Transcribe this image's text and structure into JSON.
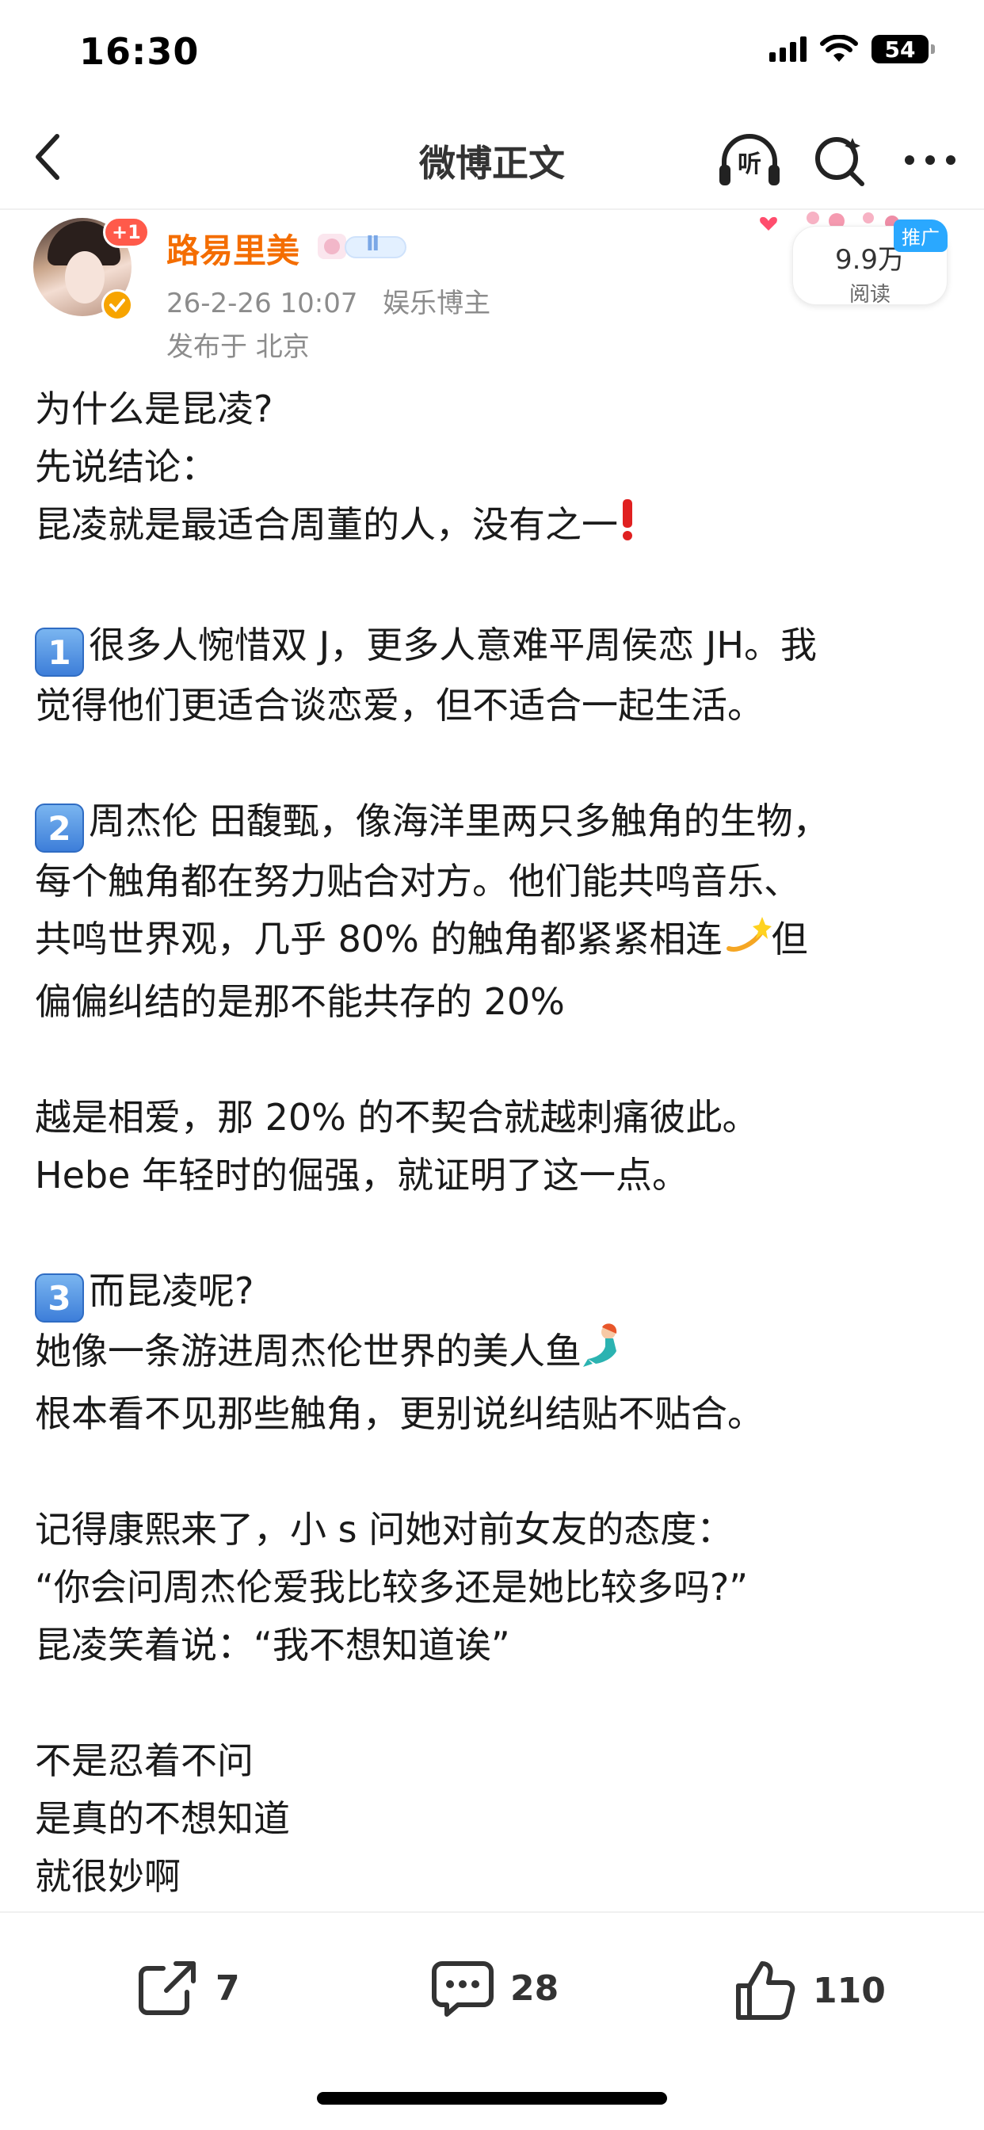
{
  "status": {
    "time": "16:30",
    "battery": "54"
  },
  "nav": {
    "title": "微博正文",
    "listen_label": "听"
  },
  "author": {
    "name": "路易里美",
    "follow_badge": "+1",
    "member_level": "Ⅱ",
    "date": "26-2-26 10:07",
    "category": "娱乐博主",
    "location": "发布于 北京",
    "views_count": "9.9万",
    "views_label": "阅读",
    "promo_tag": "推广"
  },
  "post": {
    "p1": "为什么是昆凌?",
    "p2": "先说结论：",
    "p3": "昆凌就是最适合周董的人，没有之一",
    "p3_emoji": "❗",
    "k1": "1",
    "p4": "很多人惋惜双 J，更多人意难平周侯恋 JH。我",
    "p5": "觉得他们更适合谈恋爱，但不适合一起生活。",
    "k2": "2",
    "p6": "周杰伦 田馥甄，像海洋里两只多触角的生物，",
    "p7": "每个触角都在努力贴合对方。他们能共鸣音乐、",
    "p8a": "共鸣世界观，几乎 80% 的触角都紧紧相连",
    "p8_emoji": "💫",
    "p8b": "但",
    "p9": "偏偏纠结的是那不能共存的 20%",
    "p10": "越是相爱，那 20% 的不契合就越刺痛彼此。",
    "p11": "Hebe 年轻时的倔强，就证明了这一点。",
    "k3": "3",
    "p12": "而昆凌呢?",
    "p13": "她像一条游进周杰伦世界的美人鱼",
    "p13_emoji": "🧜",
    "p14": "根本看不见那些触角，更别说纠结贴不贴合。",
    "p15": "记得康熙来了，小 s 问她对前女友的态度：",
    "p16": "“你会问周杰伦爱我比较多还是她比较多吗?”",
    "p17": "昆凌笑着说：“我不想知道诶”",
    "p18": "不是忍着不问",
    "p19": "是真的不想知道",
    "p20": "就很妙啊"
  },
  "actions": {
    "share_count": "7",
    "comment_count": "28",
    "like_count": "110"
  },
  "colors": {
    "author_name": "#f46d00",
    "keycap": "#3d7ed9",
    "promo": "#2aa8ff"
  }
}
